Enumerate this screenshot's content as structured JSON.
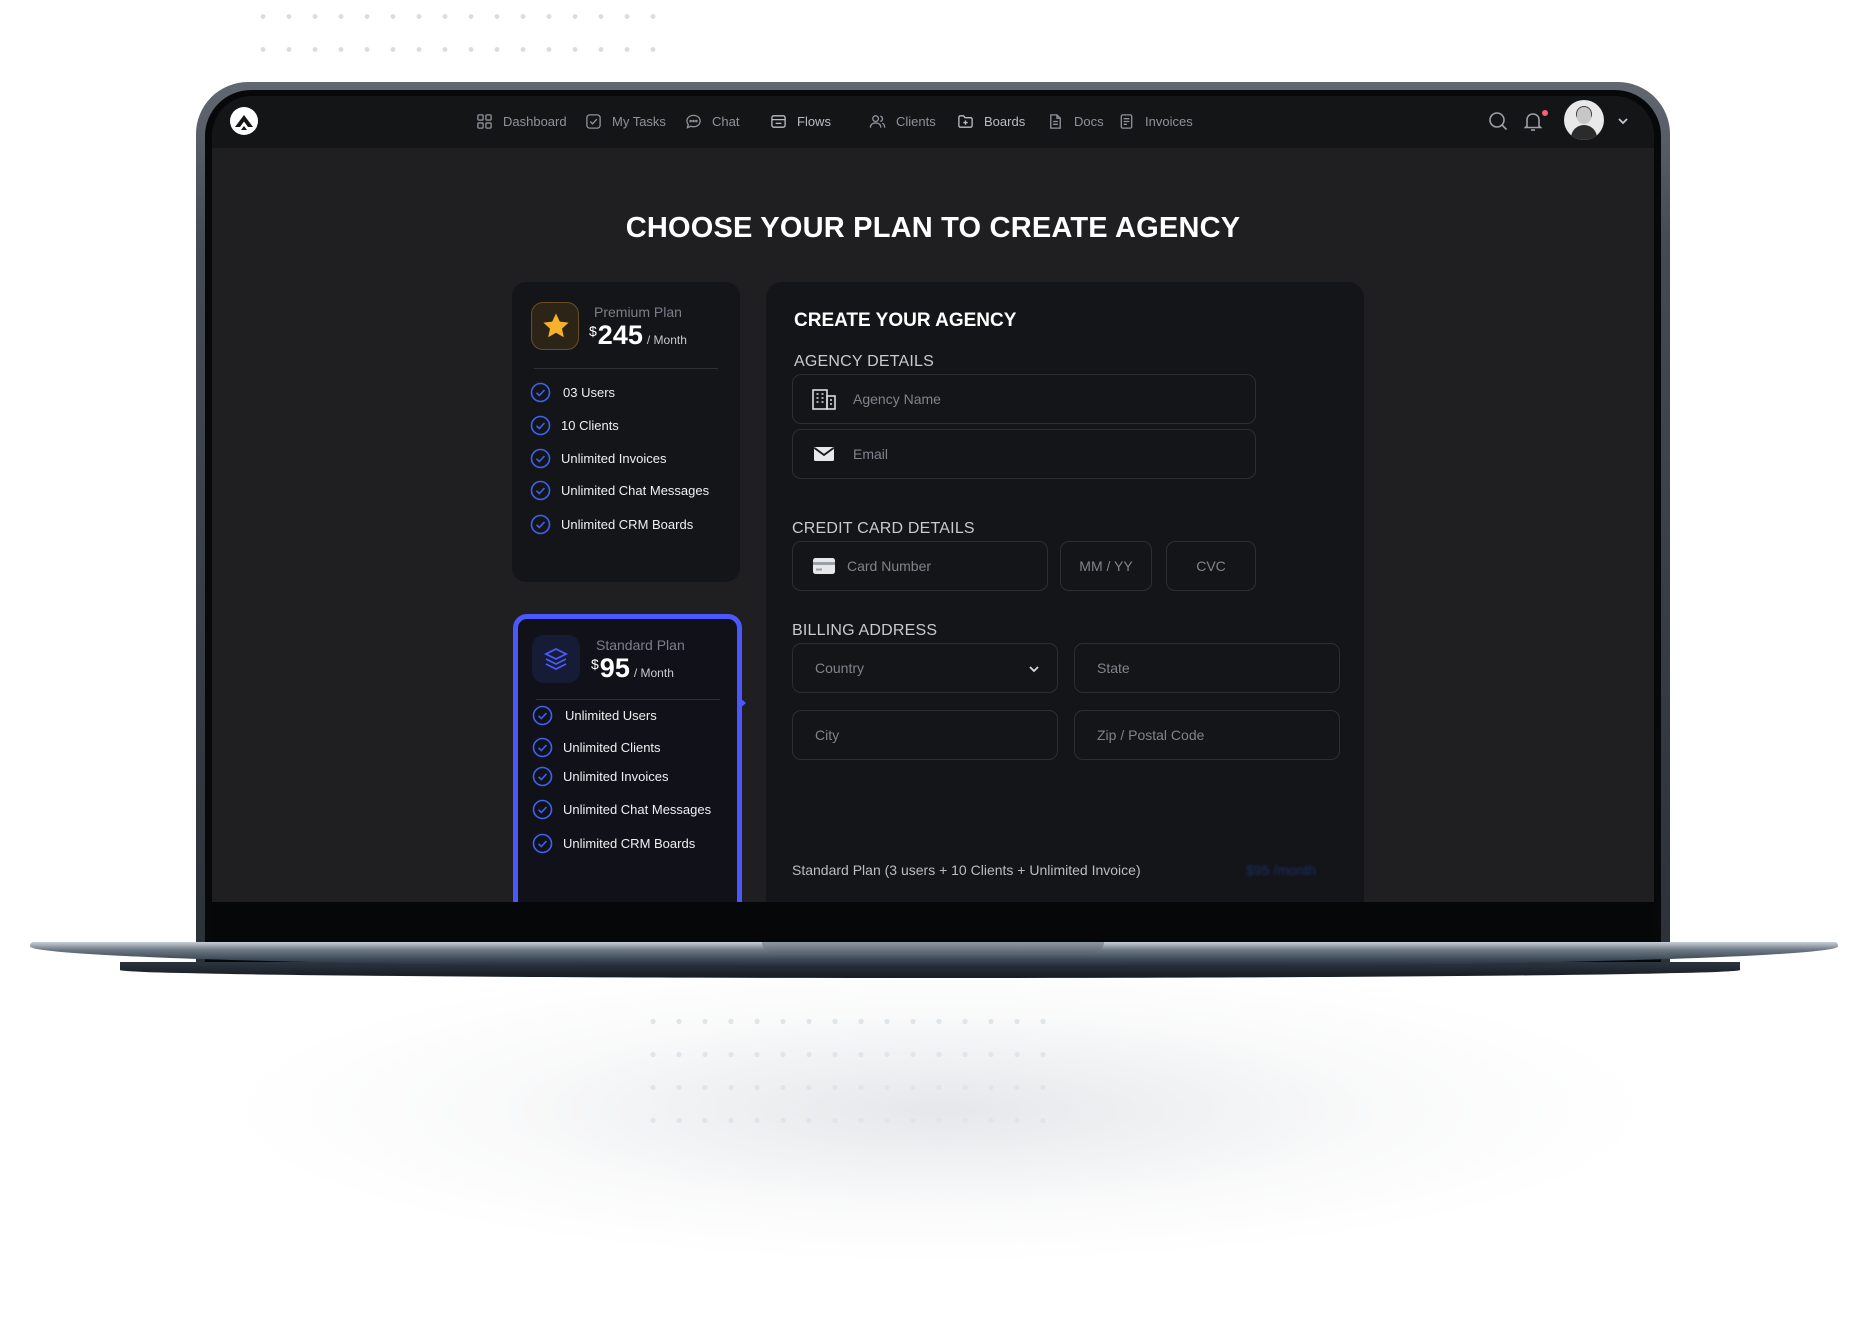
{
  "nav": {
    "items": [
      {
        "label": "Dashboard",
        "icon": "grid-icon"
      },
      {
        "label": "My Tasks",
        "icon": "check-square-icon"
      },
      {
        "label": "Chat",
        "icon": "chat-bubble-icon"
      },
      {
        "label": "Flows",
        "icon": "flows-icon"
      },
      {
        "label": "Clients",
        "icon": "users-icon"
      },
      {
        "label": "Boards",
        "icon": "folder-plus-icon"
      },
      {
        "label": "Docs",
        "icon": "document-icon"
      },
      {
        "label": "Invoices",
        "icon": "invoice-icon"
      }
    ],
    "right_icons": [
      "search-icon",
      "bell-icon",
      "avatar",
      "chevron-down-icon"
    ]
  },
  "page": {
    "title": "CHOOSE YOUR PLAN TO CREATE AGENCY"
  },
  "plans": [
    {
      "name": "Premium Plan",
      "currency": "$",
      "price": "245",
      "period": "/ Month",
      "icon": "star-icon",
      "selected": false,
      "features": [
        "03 Users",
        "10 Clients",
        "Unlimited Invoices",
        "Unlimited Chat Messages",
        "Unlimited CRM Boards"
      ]
    },
    {
      "name": "Standard Plan",
      "currency": "$",
      "price": "95",
      "period": "/ Month",
      "icon": "layers-icon",
      "selected": true,
      "features": [
        "Unlimited Users",
        "Unlimited Clients",
        "Unlimited Invoices",
        "Unlimited Chat Messages",
        "Unlimited CRM Boards"
      ]
    }
  ],
  "form": {
    "title": "CREATE YOUR AGENCY",
    "agency_section": "AGENCY DETAILS",
    "agency_name_placeholder": "Agency Name",
    "email_placeholder": "Email",
    "card_section": "CREDIT CARD DETAILS",
    "card_number_placeholder": "Card Number",
    "expiry_placeholder": "MM / YY",
    "cvc_placeholder": "CVC",
    "billing_section": "BILLING ADDRESS",
    "country_placeholder": "Country",
    "state_placeholder": "State",
    "city_placeholder": "City",
    "zip_placeholder": "Zip / Postal Code",
    "summary": "Standard Plan (3 users + 10 Clients + Unlimited Invoice)",
    "summary_price": "$95 /month"
  },
  "colors": {
    "accent": "#4a59ff",
    "check": "#3d62f0",
    "star": "#f6b22d",
    "background": "#1f1f21",
    "panel": "#141518"
  }
}
